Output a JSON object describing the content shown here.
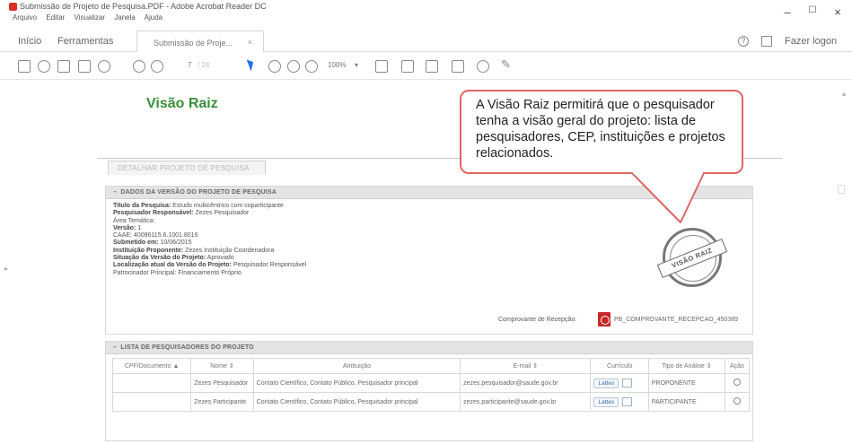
{
  "window": {
    "title": "Submissão de Projeto de Pesquisa.PDF - Adobe Acrobat Reader DC",
    "controls": [
      "–",
      "☐",
      "×"
    ]
  },
  "menu": [
    "Arquivo",
    "Editar",
    "Visualizar",
    "Janela",
    "Ajuda"
  ],
  "tabs": {
    "home": "Início",
    "tools": "Ferramentas",
    "document": "Submissão de Proje...",
    "login": "Fazer logon"
  },
  "toolbar": {
    "page_current": "7",
    "page_total": "/ 24",
    "zoom": "100%"
  },
  "document": {
    "visao_title": "Visão Raiz",
    "callout": "A Visão Raiz permitirá que o pesquisador tenha a visão geral do projeto: lista de pesquisadores, CEP, instituições e projetos relacionados.",
    "detalhar_tab": "DETALHAR PROJETO DE PESQUISA",
    "version_panel": {
      "header": "DADOS DA VERSÃO DO PROJETO DE PESQUISA",
      "fields": [
        {
          "label": "Título da Pesquisa:",
          "value": "Estudo multicêntrico com coparticipante"
        },
        {
          "label": "Pesquisador Responsável:",
          "value": "Zezes Pesquisador"
        },
        {
          "label": "Área Temática:",
          "value": ""
        },
        {
          "label": "Versão:",
          "value": "1"
        },
        {
          "label": "CAAE:",
          "value": "40086115.6.1001.8016"
        },
        {
          "label": "Submetido em:",
          "value": "10/06/2015"
        },
        {
          "label": "Instituição Proponente:",
          "value": "Zezes Instituição Coordenadora"
        },
        {
          "label": "Situação da Versão do Projeto:",
          "value": "Aprovado"
        },
        {
          "label": "Localização atual da Versão do Projeto:",
          "value": "Pesquisador Responsável"
        },
        {
          "label": "Patrocinador Principal:",
          "value": "Financiamento Próprio"
        }
      ],
      "comprovante_label": "Comprovante de Recepção:",
      "comprovante_file": "PB_COMPROVANTE_RECEPCAO_450389"
    },
    "stamp_text": "VISÃO RAIZ",
    "researchers_panel": {
      "header": "LISTA DE PESQUISADORES DO PROJETO",
      "columns": [
        "CPF/Documento ▲",
        "Nome ⇕",
        "Atribuição",
        "E-mail ⇕",
        "Currículo",
        "Tipo de Análise ⇕",
        "Ação"
      ],
      "rows": [
        {
          "cpf": "",
          "nome": "Zezes Pesquisador",
          "atribuicao": "Contato Científico, Contato Público, Pesquisador principal",
          "email": "zezes.pesquisador@saude.gov.br",
          "curriculo": "Lattes",
          "tipo": "PROPONENTE"
        },
        {
          "cpf": "",
          "nome": "Zezes Participante",
          "atribuicao": "Contato Científico, Contato Público, Pesquisador principal",
          "email": "zezes.participante@saude.gov.br",
          "curriculo": "Lattes",
          "tipo": "PARTICIPANTE"
        }
      ]
    }
  }
}
